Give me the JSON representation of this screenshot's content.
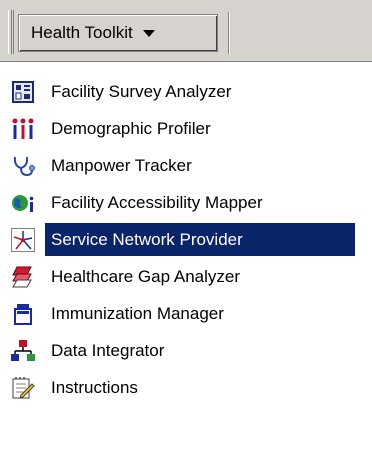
{
  "toolbar": {
    "button_label": "Health Toolkit"
  },
  "menu": {
    "items": [
      {
        "label": "Facility Survey Analyzer",
        "icon": "survey-grid-icon"
      },
      {
        "label": "Demographic Profiler",
        "icon": "people-icon"
      },
      {
        "label": "Manpower Tracker",
        "icon": "stethoscope-icon"
      },
      {
        "label": "Facility Accessibility Mapper",
        "icon": "globe-info-icon"
      },
      {
        "label": "Service Network Provider",
        "icon": "network-star-icon",
        "selected": true
      },
      {
        "label": "Healthcare Gap Analyzer",
        "icon": "layers-gap-icon"
      },
      {
        "label": "Immunization Manager",
        "icon": "vial-icon"
      },
      {
        "label": "Data Integrator",
        "icon": "hierarchy-icon"
      },
      {
        "label": "Instructions",
        "icon": "notepad-pencil-icon"
      }
    ]
  },
  "colors": {
    "selection": "#0a246a",
    "toolbar": "#d6d3ce"
  }
}
